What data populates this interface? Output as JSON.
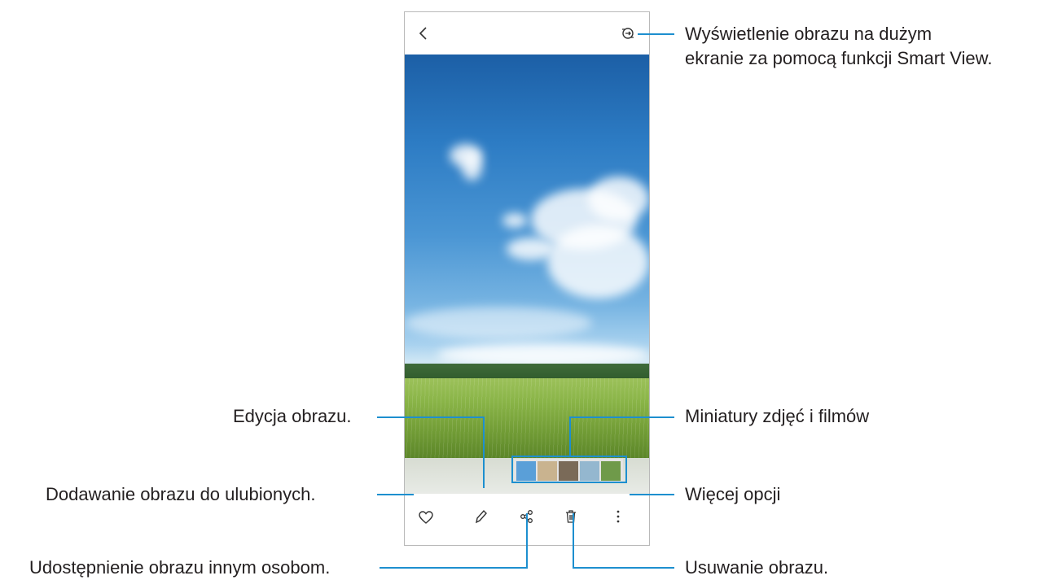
{
  "callouts": {
    "smart_view": {
      "line1": "Wyświetlenie obrazu na dużym",
      "line2": "ekranie za pomocą funkcji Smart View."
    },
    "edit": "Edycja obrazu.",
    "thumbnails": "Miniatury zdjęć i filmów",
    "favorite": "Dodawanie obrazu do ulubionych.",
    "more": "Więcej opcji",
    "share": "Udostępnienie obrazu innym osobom.",
    "delete": "Usuwanie obrazu."
  },
  "icons": {
    "back": "back-arrow-icon",
    "smart_view": "smart-view-icon",
    "favorite": "heart-icon",
    "edit": "pencil-icon",
    "share": "share-icon",
    "delete": "trash-icon",
    "more": "more-options-icon"
  },
  "thumbnails": [
    {
      "name": "thumbnail-sky",
      "color": "#5a9fd8"
    },
    {
      "name": "thumbnail-person",
      "color": "#c9b38f"
    },
    {
      "name": "thumbnail-group",
      "color": "#7a6a58"
    },
    {
      "name": "thumbnail-people",
      "color": "#94b7cf"
    },
    {
      "name": "thumbnail-field",
      "color": "#6f9a4a"
    }
  ],
  "colors": {
    "callout_line": "#1d8fcf",
    "text": "#231f20"
  }
}
